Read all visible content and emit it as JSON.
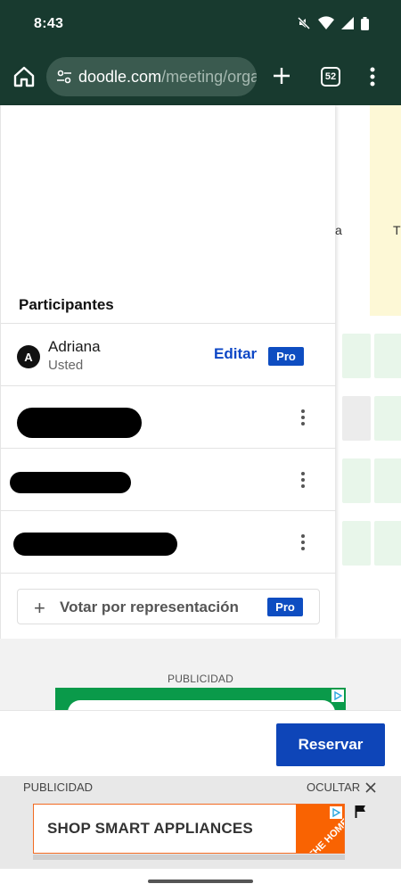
{
  "status": {
    "time": "8:43"
  },
  "browser": {
    "url_domain": "doodle.com",
    "url_path": "/meeting/organize",
    "tab_count": "52"
  },
  "grid": {
    "col_a": "a",
    "col_t": "T"
  },
  "panel": {
    "title": "Participantes",
    "participants": [
      {
        "initial": "A",
        "name": "Adriana",
        "subtitle": "Usted",
        "edit_label": "Editar",
        "badge": "Pro"
      }
    ],
    "proxy_vote_label": "Votar por representación",
    "proxy_badge": "Pro"
  },
  "ad": {
    "label": "PUBLICIDAD"
  },
  "action": {
    "reserve_label": "Reservar"
  },
  "bottom_ad": {
    "label": "PUBLICIDAD",
    "hide_label": "OCULTAR",
    "banner_text": "SHOP SMART APPLIANCES",
    "logo_text": "THE HOME DEPOT"
  },
  "colors": {
    "chrome": "#183a2f",
    "primary": "#0e45b8",
    "cell_green": "#e8f6ea",
    "highlight": "#fdf8d6"
  }
}
